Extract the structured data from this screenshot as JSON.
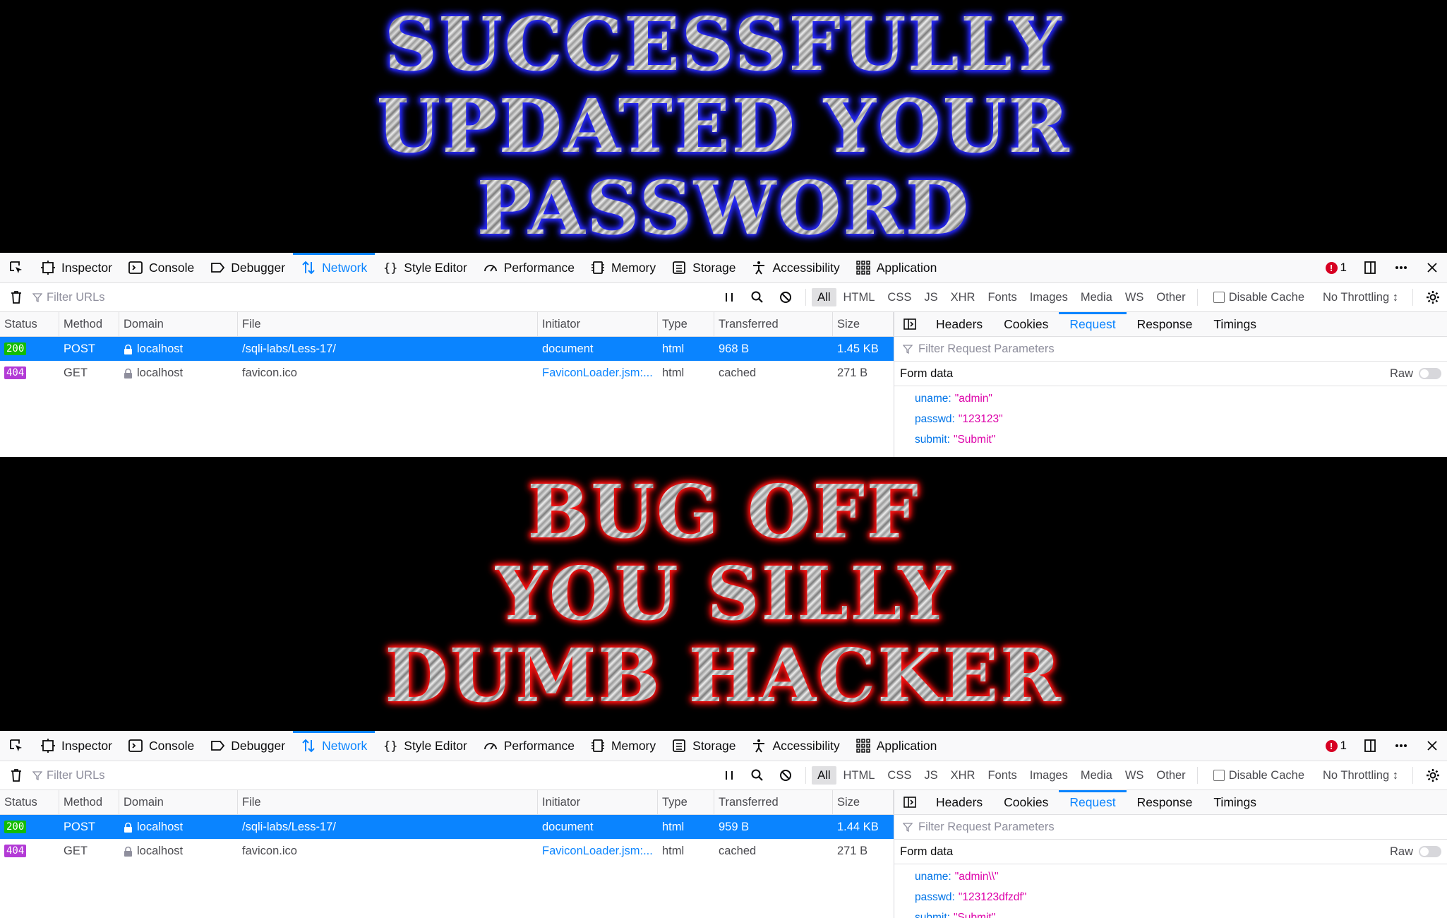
{
  "screens": [
    {
      "banner": {
        "lines": [
          "SUCCESSFULLY",
          "UPDATED YOUR",
          "PASSWORD"
        ],
        "glow_color": "#2a2cff"
      },
      "devtools": {
        "tabs": [
          "Inspector",
          "Console",
          "Debugger",
          "Network",
          "Style Editor",
          "Performance",
          "Memory",
          "Storage",
          "Accessibility",
          "Application"
        ],
        "active_tab": "Network",
        "error_count": "1",
        "filter_placeholder": "Filter URLs",
        "type_filters": [
          "All",
          "HTML",
          "CSS",
          "JS",
          "XHR",
          "Fonts",
          "Images",
          "Media",
          "WS",
          "Other"
        ],
        "disable_cache": "Disable Cache",
        "throttle": "No Throttling ↕",
        "columns": [
          "Status",
          "Method",
          "Domain",
          "File",
          "Initiator",
          "Type",
          "Transferred",
          "Size"
        ],
        "requests": [
          {
            "status": "200",
            "method": "POST",
            "domain": "localhost",
            "file": "/sqli-labs/Less-17/",
            "initiator": "document",
            "type": "html",
            "transferred": "968 B",
            "size": "1.45 KB"
          },
          {
            "status": "404",
            "method": "GET",
            "domain": "localhost",
            "file": "favicon.ico",
            "initiator": "FaviconLoader.jsm:...",
            "type": "html",
            "transferred": "cached",
            "size": "271 B"
          }
        ],
        "detail_tabs": [
          "Headers",
          "Cookies",
          "Request",
          "Response",
          "Timings"
        ],
        "active_detail_tab": "Request",
        "param_filter_placeholder": "Filter Request Parameters",
        "form_data_label": "Form data",
        "raw_label": "Raw",
        "params": [
          {
            "key": "uname:",
            "value": "\"admin\""
          },
          {
            "key": "passwd:",
            "value": "\"123123\""
          },
          {
            "key": "submit:",
            "value": "\"Submit\""
          }
        ]
      }
    },
    {
      "banner": {
        "lines": [
          "BUG OFF",
          "YOU SILLY",
          "DUMB HACKER"
        ],
        "glow_color": "#ff1010"
      },
      "devtools": {
        "tabs": [
          "Inspector",
          "Console",
          "Debugger",
          "Network",
          "Style Editor",
          "Performance",
          "Memory",
          "Storage",
          "Accessibility",
          "Application"
        ],
        "active_tab": "Network",
        "error_count": "1",
        "filter_placeholder": "Filter URLs",
        "type_filters": [
          "All",
          "HTML",
          "CSS",
          "JS",
          "XHR",
          "Fonts",
          "Images",
          "Media",
          "WS",
          "Other"
        ],
        "disable_cache": "Disable Cache",
        "throttle": "No Throttling ↕",
        "columns": [
          "Status",
          "Method",
          "Domain",
          "File",
          "Initiator",
          "Type",
          "Transferred",
          "Size"
        ],
        "requests": [
          {
            "status": "200",
            "method": "POST",
            "domain": "localhost",
            "file": "/sqli-labs/Less-17/",
            "initiator": "document",
            "type": "html",
            "transferred": "959 B",
            "size": "1.44 KB"
          },
          {
            "status": "404",
            "method": "GET",
            "domain": "localhost",
            "file": "favicon.ico",
            "initiator": "FaviconLoader.jsm:...",
            "type": "html",
            "transferred": "cached",
            "size": "271 B"
          }
        ],
        "detail_tabs": [
          "Headers",
          "Cookies",
          "Request",
          "Response",
          "Timings"
        ],
        "active_detail_tab": "Request",
        "param_filter_placeholder": "Filter Request Parameters",
        "form_data_label": "Form data",
        "raw_label": "Raw",
        "params": [
          {
            "key": "uname:",
            "value": "\"admin\\\\\""
          },
          {
            "key": "passwd:",
            "value": "\"123123dfzdf\""
          },
          {
            "key": "submit:",
            "value": "\"Submit\""
          }
        ]
      }
    }
  ]
}
